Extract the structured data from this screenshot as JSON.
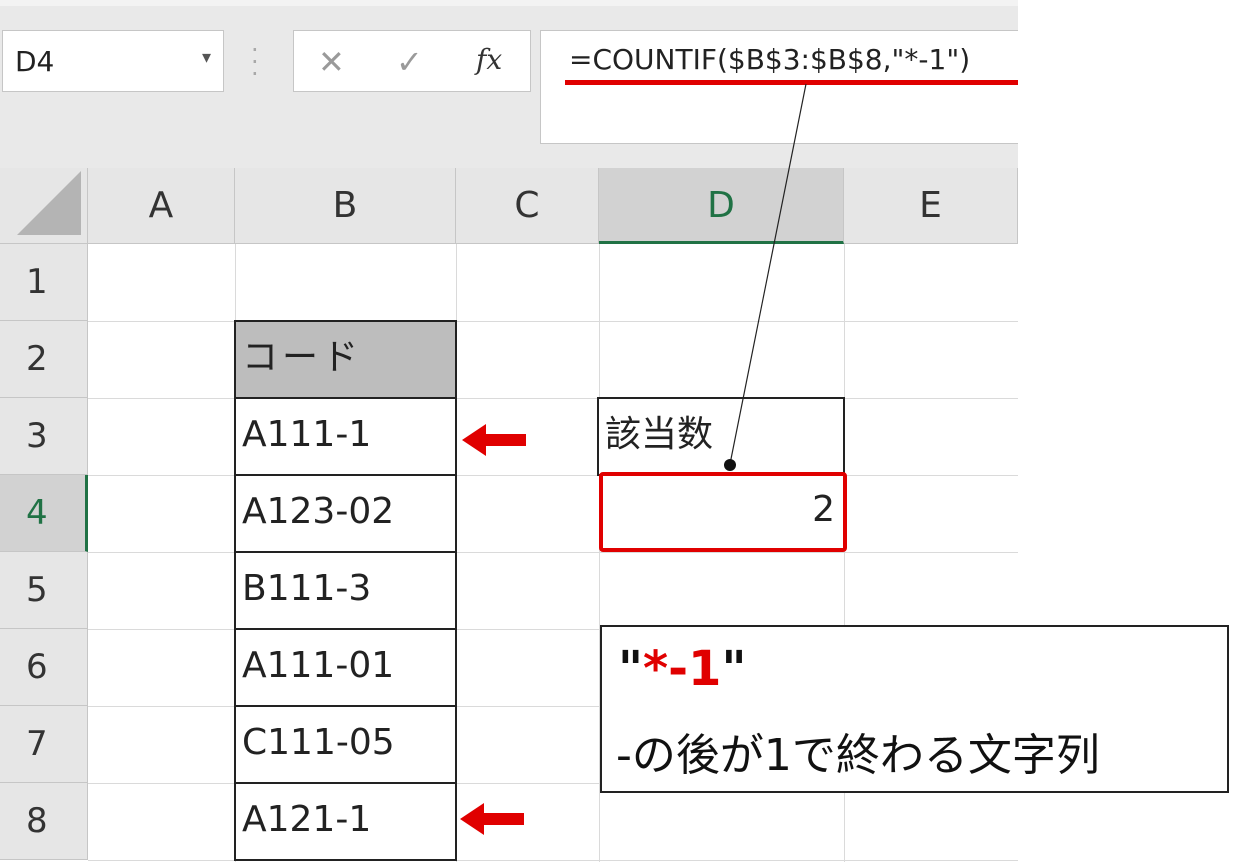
{
  "name_box": {
    "value": "D4",
    "dropdown_icon": "chevron-down-icon"
  },
  "formula_bar": {
    "cancel_icon": "close-icon",
    "confirm_icon": "check-icon",
    "fx_label": "fx",
    "formula": "=COUNTIF($B$3:$B$8,\"*-1\")"
  },
  "columns": [
    "A",
    "B",
    "C",
    "D",
    "E"
  ],
  "rows": [
    "1",
    "2",
    "3",
    "4",
    "5",
    "6",
    "7",
    "8"
  ],
  "selected_cell": "D4",
  "table": {
    "header": "コード",
    "codes": [
      "A111-1",
      "A123-02",
      "B111-3",
      "A111-01",
      "C111-05",
      "A121-1"
    ]
  },
  "result": {
    "label": "該当数",
    "value": "2"
  },
  "callout": {
    "quote_open": "\"",
    "pattern": "*-1",
    "quote_close": "\"",
    "description": "-の後が1で終わる文字列"
  },
  "colors": {
    "highlight_red": "#e00000",
    "excel_green": "#207245",
    "header_gray": "#bdbdbd"
  }
}
